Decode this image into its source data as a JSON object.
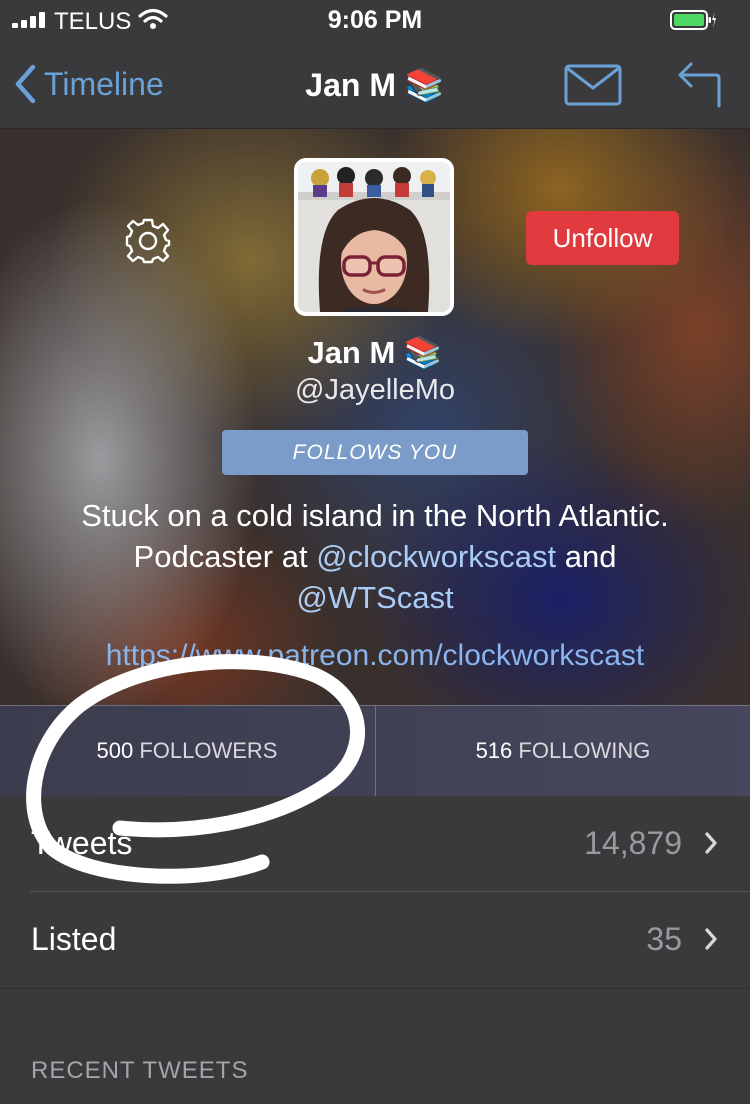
{
  "status_bar": {
    "carrier": "TELUS",
    "time": "9:06 PM"
  },
  "nav": {
    "back_label": "Timeline",
    "title": "Jan M 📚"
  },
  "profile": {
    "name": "Jan M 📚",
    "handle": "@JayelleMo",
    "follows_you": "FOLLOWS YOU",
    "unfollow_label": "Unfollow",
    "bio_line1": "Stuck on a cold island in the North Atlantic.",
    "bio_line2_prefix": "Podcaster at ",
    "bio_mention1": "@clockworkscast",
    "bio_line2_suffix": " and",
    "bio_mention2": "@WTScast",
    "link": "https://www.patreon.com/clockworkscast"
  },
  "stats": {
    "followers_count": "500",
    "followers_label": "FOLLOWERS",
    "following_count": "516",
    "following_label": "FOLLOWING"
  },
  "rows": [
    {
      "label": "Tweets",
      "count": "14,879"
    },
    {
      "label": "Listed",
      "count": "35"
    }
  ],
  "section_header": "RECENT TWEETS",
  "colors": {
    "accent": "#6aa1d6",
    "unfollow": "#e0393e",
    "badge": "#7b9cc9",
    "battery": "#4cd964"
  },
  "icons": [
    "signal-icon",
    "wifi-icon",
    "battery-icon",
    "back-chevron-icon",
    "mail-icon",
    "reply-icon",
    "gear-icon",
    "chevron-right-icon"
  ]
}
